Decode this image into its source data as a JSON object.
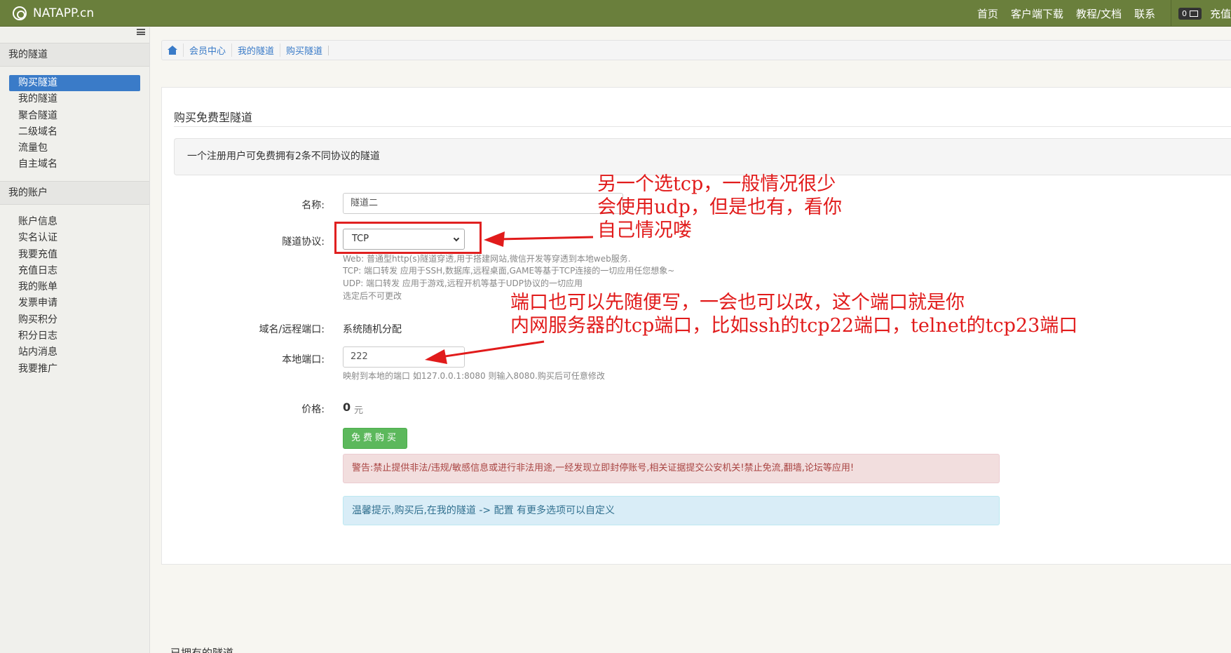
{
  "navbar": {
    "brand": "NATAPP.cn",
    "links": [
      "首页",
      "客户端下载",
      "教程/文档",
      "联系"
    ],
    "mail_count": "0",
    "recharge": "充值"
  },
  "sidebar": {
    "section1": "我的隧道",
    "items1": [
      "购买隧道",
      "我的隧道",
      "聚合隧道",
      "二级域名",
      "流量包",
      "自主域名"
    ],
    "section2": "我的账户",
    "items2": [
      "账户信息",
      "实名认证",
      "我要充值",
      "充值日志",
      "我的账单",
      "发票申请",
      "购买积分",
      "积分日志",
      "站内消息",
      "我要推广"
    ]
  },
  "breadcrumb": [
    "会员中心",
    "我的隧道",
    "购买隧道"
  ],
  "panel": {
    "title": "购买免费型隧道",
    "info": "一个注册用户可免费拥有2条不同协议的隧道"
  },
  "form": {
    "name_label": "名称:",
    "name_value": "隧道二",
    "protocol_label": "隧道协议:",
    "protocol_value": "TCP",
    "protocol_help": [
      "Web: 普通型http(s)隧道穿透,用于搭建网站,微信开发等穿透到本地web服务.",
      "TCP: 端口转发 应用于SSH,数据库,远程桌面,GAME等基于TCP连接的一切应用任您想象~",
      "UDP: 端口转发 应用于游戏,远程开机等基于UDP协议的一切应用",
      "选定后不可更改"
    ],
    "domain_label": "域名/远程端口:",
    "domain_value": "系统随机分配",
    "local_port_label": "本地端口:",
    "local_port_value": "222",
    "local_port_help": "映射到本地的端口 如127.0.0.1:8080 则输入8080.购买后可任意修改",
    "price_label": "价格:",
    "price_value": "0",
    "price_unit": "元",
    "buy_button": "免费购买",
    "warning": "警告:禁止提供非法/违规/敏感信息或进行非法用途,一经发现立即封停账号,相关证据提交公安机关!禁止免流,翻墙,论坛等应用!",
    "tip": "温馨提示,购买后,在我的隧道 -> 配置 有更多选项可以自定义"
  },
  "footer_partial": "已拥有的隧道",
  "annotations": {
    "note1": [
      "另一个选tcp，一般情况很少",
      "会使用udp，但是也有，看你",
      "自己情况喽"
    ],
    "note2": [
      "端口也可以先随便写，一会也可以改，这个端口就是你",
      "内网服务器的tcp端口，比如ssh的tcp22端口，telnet的tcp23端口"
    ],
    "color": "#e11b1b"
  }
}
